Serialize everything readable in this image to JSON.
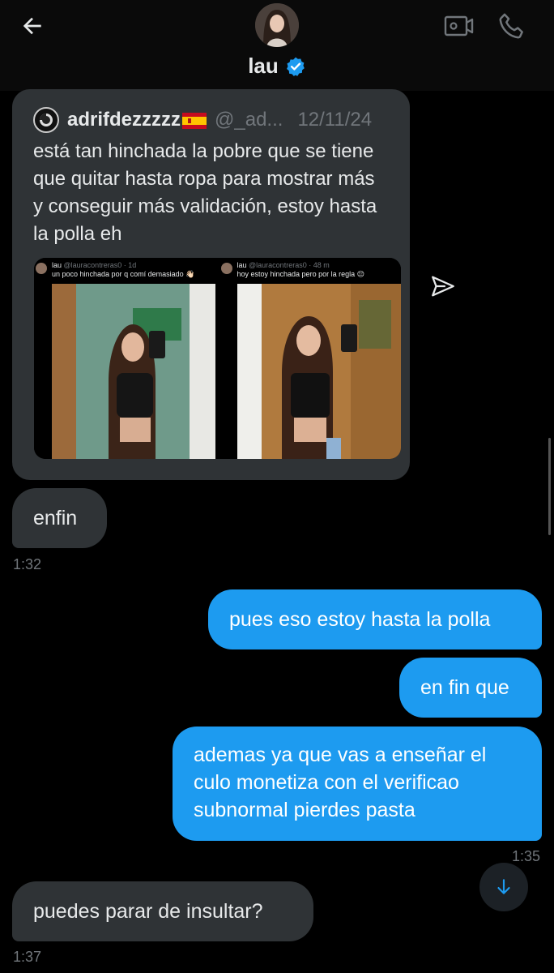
{
  "header": {
    "title": "lau",
    "verified": true,
    "back_icon": "arrow-left-icon",
    "video_icon": "video-call-icon",
    "phone_icon": "phone-icon"
  },
  "quoted_post": {
    "author_name": "adrifdezzzzz",
    "author_flag": "spain-flag",
    "handle": "@_ad...",
    "date": "12/11/24",
    "text": "está tan hinchada la pobre que se tiene que quitar hasta ropa para mostrar más y conseguir más validación, estoy hasta la polla eh",
    "embedded": [
      {
        "name": "lau",
        "handle": "@lauracontreras0 · 1d",
        "text": "un poco hinchada por q comí demasiado 👋🏻"
      },
      {
        "name": "lau",
        "handle": "@lauracontreras0 · 48 m",
        "text": "hoy estoy hinchada pero por la regla 😔"
      }
    ]
  },
  "messages": [
    {
      "side": "in",
      "text": "enfin",
      "time": "1:32"
    },
    {
      "side": "out",
      "text": "pues eso estoy hasta la polla"
    },
    {
      "side": "out",
      "text": "en fin que"
    },
    {
      "side": "out",
      "text": "ademas ya que vas a enseñar el culo monetiza con el verificao subnormal pierdes pasta",
      "time": "1:35"
    },
    {
      "side": "in",
      "text": "puedes parar de insultar?",
      "time": "1:37"
    }
  ],
  "colors": {
    "accent": "#1d9bf0",
    "incoming_bubble": "#2f3336",
    "background": "#000000",
    "muted": "#71767b"
  }
}
